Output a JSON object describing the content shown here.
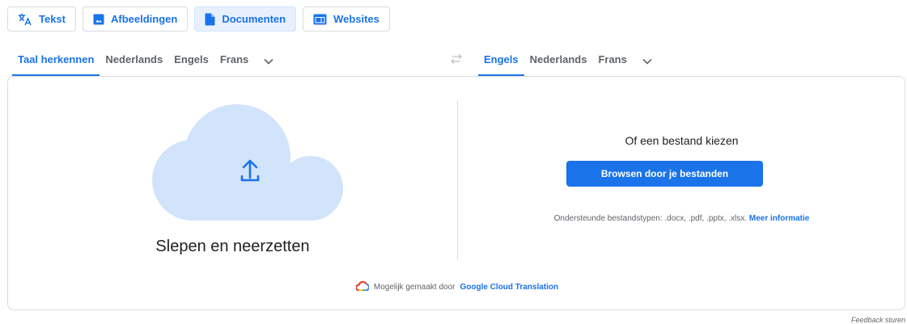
{
  "modes": [
    {
      "label": "Tekst",
      "icon": "translate-icon",
      "active": false
    },
    {
      "label": "Afbeeldingen",
      "icon": "image-icon",
      "active": false
    },
    {
      "label": "Documenten",
      "icon": "document-icon",
      "active": true
    },
    {
      "label": "Websites",
      "icon": "website-icon",
      "active": false
    }
  ],
  "source_languages": [
    "Taal herkennen",
    "Nederlands",
    "Engels",
    "Frans"
  ],
  "target_languages": [
    "Engels",
    "Nederlands",
    "Frans"
  ],
  "upload": {
    "drag_drop_text": "Slepen en neerzetten",
    "choose_file_text": "Of een bestand kiezen",
    "browse_button": "Browsen door je bestanden",
    "supported_types": "Ondersteunde bestandstypen: .docx, .pdf, .pptx, .xlsx.",
    "more_info": "Meer informatie"
  },
  "powered_by": {
    "prefix": "Mogelijk gemaakt door",
    "link": "Google Cloud Translation"
  },
  "feedback": "Feedback sturen",
  "colors": {
    "accent": "#1a73e8",
    "active_tab_bg": "#e8f0fe",
    "cloud": "#d2e3fc"
  }
}
